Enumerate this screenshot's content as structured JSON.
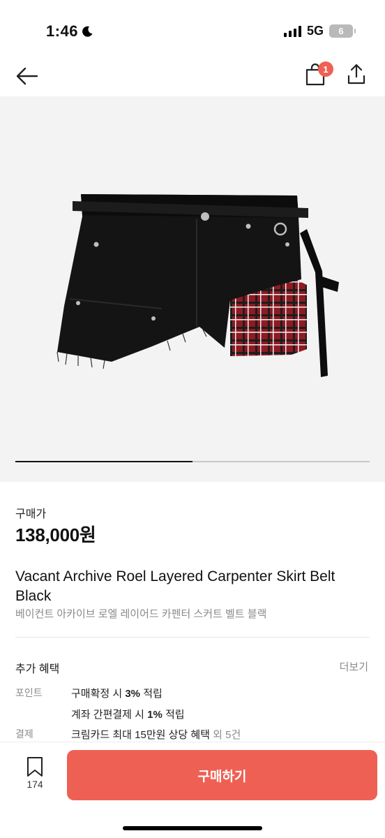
{
  "status_bar": {
    "time": "1:46",
    "network": "5G",
    "battery": "6",
    "icons": [
      "moon-icon",
      "signal-icon",
      "battery-icon"
    ]
  },
  "nav": {
    "icons": [
      "back-arrow-icon",
      "shopping-bag-icon",
      "share-icon"
    ],
    "cart_badge": "1"
  },
  "gallery": {
    "image_alt": "black denim carpenter mini skirt with red plaid layered panel and belt",
    "page_progress": 0.5
  },
  "product": {
    "price_label": "구매가",
    "price": "138,000원",
    "title": "Vacant Archive Roel Layered Carpenter Skirt Belt Black",
    "subtitle": "베이컨트 아카이브 로엘 레이어드 카펜터 스커트 벨트 블랙"
  },
  "benefits": {
    "title": "추가 혜택",
    "more": "더보기",
    "rows": [
      {
        "label": "포인트",
        "pre": "구매확정 시 ",
        "bold": "3%",
        "post": " 적립",
        "extra": ""
      },
      {
        "label": "",
        "pre": "계좌 간편결제 시 ",
        "bold": "1%",
        "post": " 적립",
        "extra": ""
      },
      {
        "label": "결제",
        "pre": "크림카드 최대 15만원 상당 혜택",
        "bold": "",
        "post": "",
        "extra": " 외 5건"
      }
    ]
  },
  "bottom_bar": {
    "like_count": "174",
    "buy_label": "구매하기"
  },
  "colors": {
    "accent": "#ef6054",
    "muted_text": "#8a8a8a",
    "gallery_bg": "#f3f3f3"
  }
}
